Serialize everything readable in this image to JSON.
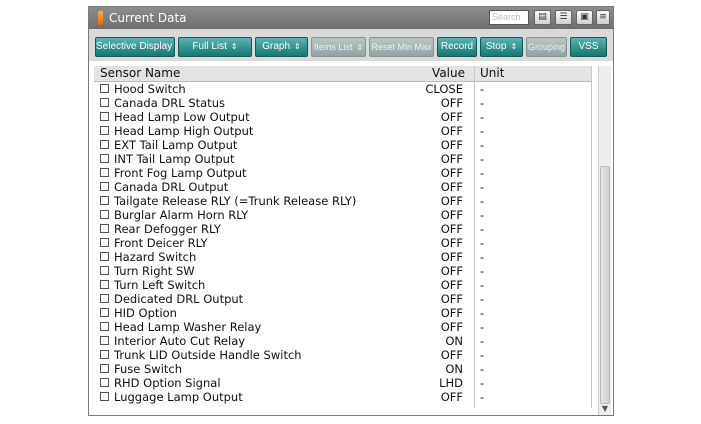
{
  "window": {
    "title": "Current Data"
  },
  "search": {
    "placeholder": "Search"
  },
  "toolbar": {
    "selective_display": "Selective Display",
    "full_list": "Full List",
    "graph": "Graph",
    "items_list": "Items List",
    "reset_minmax": "Reset Min.Max",
    "record": "Record",
    "stop": "Stop",
    "grouping": "Grouping",
    "vss": "VSS"
  },
  "table": {
    "columns": {
      "name": "Sensor Name",
      "value": "Value",
      "unit": "Unit"
    },
    "rows": [
      {
        "name": "Hood Switch",
        "value": "CLOSE",
        "unit": "-"
      },
      {
        "name": "Canada DRL Status",
        "value": "OFF",
        "unit": "-"
      },
      {
        "name": "Head Lamp Low Output",
        "value": "OFF",
        "unit": "-"
      },
      {
        "name": "Head Lamp High Output",
        "value": "OFF",
        "unit": "-"
      },
      {
        "name": "EXT Tail Lamp Output",
        "value": "OFF",
        "unit": "-"
      },
      {
        "name": "INT Tail Lamp Output",
        "value": "OFF",
        "unit": "-"
      },
      {
        "name": "Front Fog Lamp Output",
        "value": "OFF",
        "unit": "-"
      },
      {
        "name": "Canada DRL Output",
        "value": "OFF",
        "unit": "-"
      },
      {
        "name": "Tailgate Release RLY (=Trunk Release RLY)",
        "value": "OFF",
        "unit": "-"
      },
      {
        "name": "Burglar Alarm Horn RLY",
        "value": "OFF",
        "unit": "-"
      },
      {
        "name": "Rear Defogger RLY",
        "value": "OFF",
        "unit": "-"
      },
      {
        "name": "Front Deicer RLY",
        "value": "OFF",
        "unit": "-"
      },
      {
        "name": "Hazard Switch",
        "value": "OFF",
        "unit": "-"
      },
      {
        "name": "Turn Right SW",
        "value": "OFF",
        "unit": "-"
      },
      {
        "name": "Turn Left Switch",
        "value": "OFF",
        "unit": "-"
      },
      {
        "name": "Dedicated DRL Output",
        "value": "OFF",
        "unit": "-"
      },
      {
        "name": "HID Option",
        "value": "OFF",
        "unit": "-"
      },
      {
        "name": "Head Lamp Washer Relay",
        "value": "OFF",
        "unit": "-"
      },
      {
        "name": "Interior Auto Cut Relay",
        "value": "ON",
        "unit": "-"
      },
      {
        "name": "Trunk LID Outside Handle Switch",
        "value": "OFF",
        "unit": "-"
      },
      {
        "name": "Fuse Switch",
        "value": "ON",
        "unit": "-"
      },
      {
        "name": "RHD Option Signal",
        "value": "LHD",
        "unit": "-"
      },
      {
        "name": "Luggage Lamp Output",
        "value": "OFF",
        "unit": "-"
      }
    ]
  }
}
